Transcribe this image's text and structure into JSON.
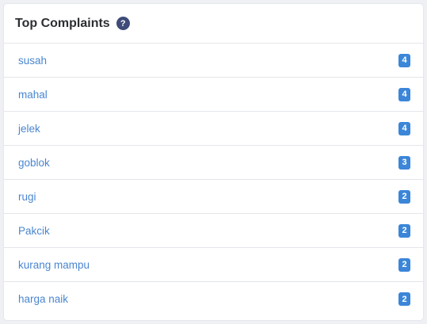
{
  "card": {
    "title": "Top Complaints",
    "help_icon": "?"
  },
  "complaints": [
    {
      "label": "susah",
      "count": "4"
    },
    {
      "label": "mahal",
      "count": "4"
    },
    {
      "label": "jelek",
      "count": "4"
    },
    {
      "label": "goblok",
      "count": "3"
    },
    {
      "label": "rugi",
      "count": "2"
    },
    {
      "label": "Pakcik",
      "count": "2"
    },
    {
      "label": "kurang mampu",
      "count": "2"
    },
    {
      "label": "harga naik",
      "count": "2"
    }
  ],
  "colors": {
    "link": "#4a86cf",
    "badge": "#3b86d8",
    "help_icon": "#3f4b78"
  }
}
